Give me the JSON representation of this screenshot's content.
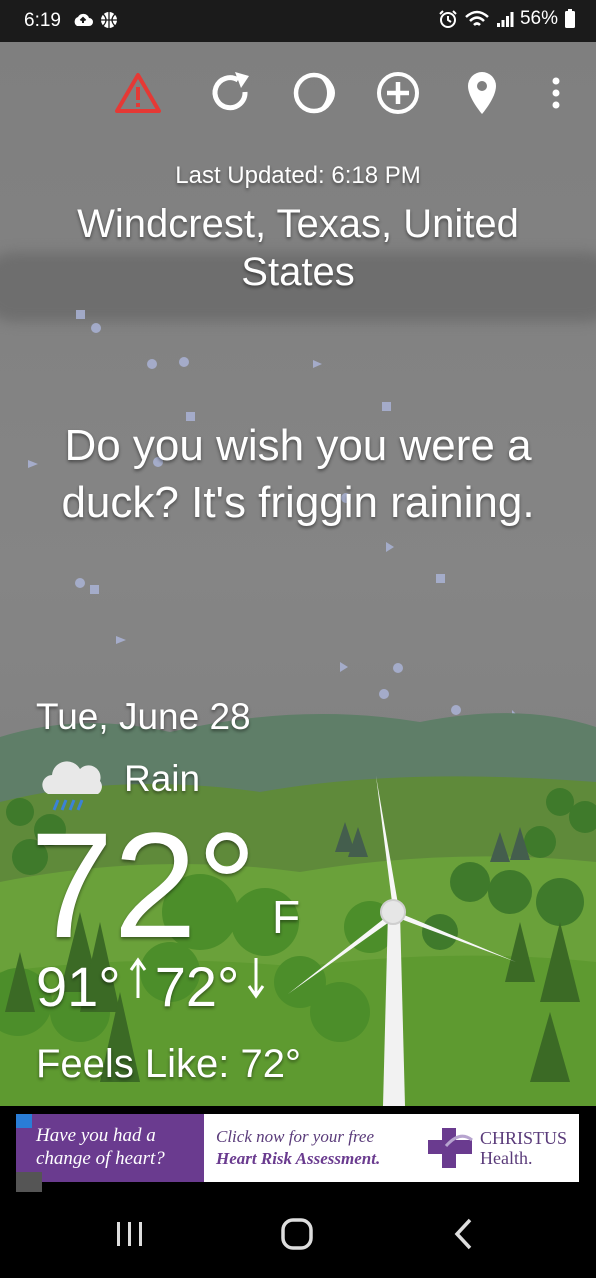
{
  "status": {
    "time": "6:19",
    "battery": "56%",
    "icons_left": [
      "cloud-upload-icon",
      "basketball-icon"
    ],
    "icons_right": [
      "alarm-icon",
      "wifi-icon",
      "signal-icon",
      "battery-icon"
    ]
  },
  "toolbar": {
    "items": [
      "warning-icon",
      "refresh-icon",
      "moon-icon",
      "add-location-icon",
      "location-pin-icon",
      "overflow-menu-icon"
    ],
    "warning_color": "#e53935"
  },
  "weather": {
    "last_updated": "Last Updated: 6:18 PM",
    "location": "Windcrest, Texas, United States",
    "snark": "Do you wish you were a duck? It's friggin raining.",
    "date": "Tue, June 28",
    "condition": "Rain",
    "condition_icon": "rain-cloud-icon",
    "temp": "72°",
    "unit": "F",
    "high": "91°",
    "low": "72°",
    "feels_like": "Feels Like:  72°"
  },
  "ad": {
    "left_text": "Have you had a change of heart?",
    "mid_line1": "Click now for your free",
    "mid_line2": "Heart Risk Assessment.",
    "brand_name": "CHRISTUS",
    "brand_sub": "Health."
  },
  "nav": {
    "items": [
      "recent-apps-icon",
      "home-icon",
      "back-icon"
    ]
  }
}
